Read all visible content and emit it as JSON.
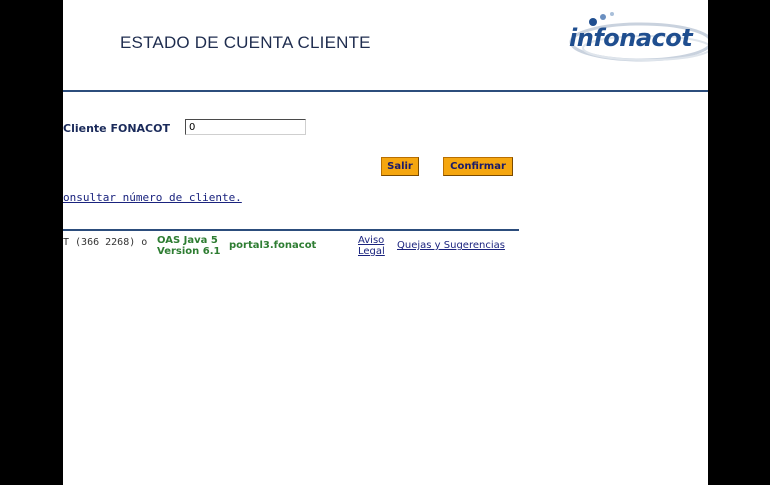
{
  "header": {
    "title": "ESTADO DE CUENTA CLIENTE",
    "logo_text": "infonacot"
  },
  "form": {
    "client_label": "Cliente FONACOT",
    "client_value": "0"
  },
  "buttons": {
    "salir": "Salir",
    "confirmar": "Confirmar"
  },
  "links": {
    "consult": "onsultar número de cliente."
  },
  "footer": {
    "phone": "T (366 2268) o",
    "oas_line1": "OAS Java 5",
    "oas_line2": "Version 6.1",
    "server": "portal3.fonacot",
    "aviso_line1": "Aviso",
    "aviso_line2": "Legal",
    "quejas": "Quejas y Sugerencias"
  },
  "colors": {
    "accent_button": "#f5a60f",
    "header_text": "#1f2d4f",
    "rule": "#2c4d7c",
    "footer_green": "#2e7d32",
    "link": "#1a237e",
    "logo_blue": "#1f4e8f"
  }
}
